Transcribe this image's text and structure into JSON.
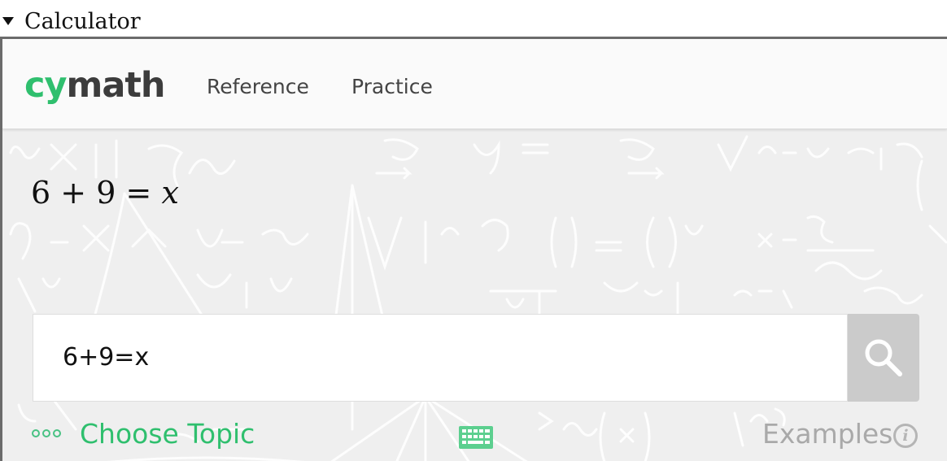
{
  "details": {
    "summary": "Calculator"
  },
  "navbar": {
    "logo_cy": "cy",
    "logo_math": "math",
    "links": [
      "Reference",
      "Practice"
    ]
  },
  "equation": {
    "lhs_a": "6",
    "plus": "+",
    "lhs_b": "9",
    "equals": "=",
    "rhs": "x"
  },
  "input": {
    "value": "6+9=x"
  },
  "bottom": {
    "choose_topic": "Choose Topic",
    "examples": "Examples",
    "info_glyph": "i"
  },
  "icons": [
    "caret-down-icon",
    "search-icon",
    "dots-icon",
    "keyboard-icon",
    "info-icon"
  ],
  "colors": {
    "brand_green": "#2fbf6e",
    "logo_dark": "#3c3c3c",
    "search_bg": "#cbcbcb",
    "examples_gray": "#a9a9a9"
  }
}
